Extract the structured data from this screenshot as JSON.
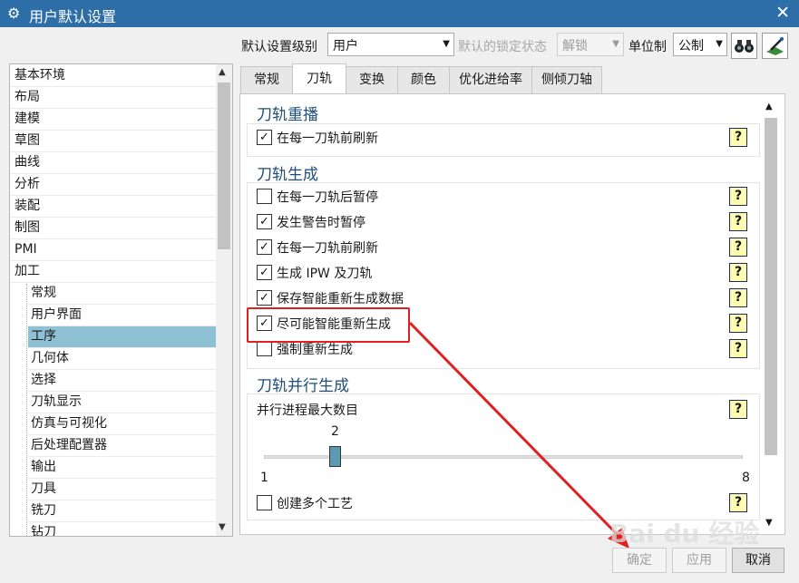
{
  "window": {
    "title": "用户默认设置",
    "icon": "gear-icon",
    "close": "✕"
  },
  "toolbar": {
    "level_label": "默认设置级别",
    "level_value": "用户",
    "lock_label": "默认的锁定状态",
    "lock_value": "解锁",
    "unit_label": "单位制",
    "unit_value": "公制",
    "binoculars_icon": "binoculars-icon",
    "wizard_icon": "wand-icon"
  },
  "tree": {
    "items": [
      "基本环境",
      "布局",
      "建模",
      "草图",
      "曲线",
      "分析",
      "装配",
      "制图",
      "PMI",
      "加工"
    ],
    "sub_items": [
      "常规",
      "用户界面",
      "工序",
      "几何体",
      "选择",
      "刀轨显示",
      "仿真与可视化",
      "后处理配置器",
      "输出",
      "刀具",
      "铣刀",
      "钻刀"
    ],
    "selected": "工序"
  },
  "tabs": [
    "常规",
    "刀轨",
    "变换",
    "颜色",
    "优化进给率",
    "侧倾刀轴"
  ],
  "active_tab": "刀轨",
  "replay": {
    "title": "刀轨重播",
    "options": [
      {
        "label": "在每一刀轨前刷新",
        "checked": true
      }
    ]
  },
  "generate": {
    "title": "刀轨生成",
    "options": [
      {
        "label": "在每一刀轨后暂停",
        "checked": false
      },
      {
        "label": "发生警告时暂停",
        "checked": true
      },
      {
        "label": "在每一刀轨前刷新",
        "checked": true
      },
      {
        "label": "生成 IPW 及刀轨",
        "checked": true
      },
      {
        "label": "保存智能重新生成数据",
        "checked": true
      },
      {
        "label": "尽可能智能重新生成",
        "checked": true
      },
      {
        "label": "强制重新生成",
        "checked": false
      }
    ]
  },
  "parallel": {
    "title": "刀轨并行生成",
    "max_label": "并行进程最大数目",
    "value": "2",
    "min": "1",
    "max": "8",
    "multi_label": "创建多个工艺",
    "multi_checked": false
  },
  "help_glyph": "?",
  "check_glyph": "✓",
  "buttons": {
    "ok": "确定",
    "apply": "应用",
    "cancel": "取消"
  },
  "watermark": "Bai du 经验",
  "colors": {
    "titlebar": "#2e6ea8",
    "selected": "#8fc1d5",
    "annotation": "#e02020",
    "group_title": "#1f4f7a",
    "help_bg": "#fefcb0"
  }
}
